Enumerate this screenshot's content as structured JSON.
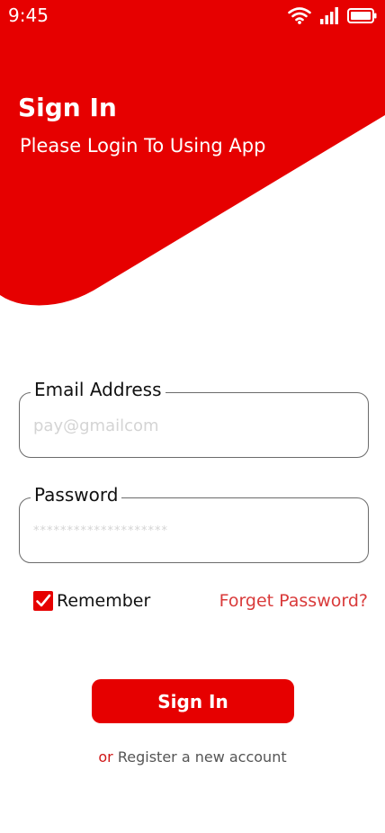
{
  "theme": {
    "accent": "#e60000",
    "link_color": "#d93a3a"
  },
  "status_bar": {
    "time": "9:45",
    "icons": [
      "wifi-icon",
      "signal-icon",
      "battery-icon"
    ]
  },
  "hero": {
    "title": "Sign In",
    "subtitle": "Please Login To Using App"
  },
  "form": {
    "email": {
      "label": "Email Address",
      "placeholder": "pay@gmailcom",
      "value": ""
    },
    "password": {
      "label": "Password",
      "placeholder": "********************",
      "value": ""
    },
    "remember": {
      "label": "Remember",
      "checked": true
    },
    "forget_label": "Forget Password?",
    "submit_label": "Sign In"
  },
  "footer": {
    "or_text": "or",
    "register_text": "Register a new account"
  }
}
